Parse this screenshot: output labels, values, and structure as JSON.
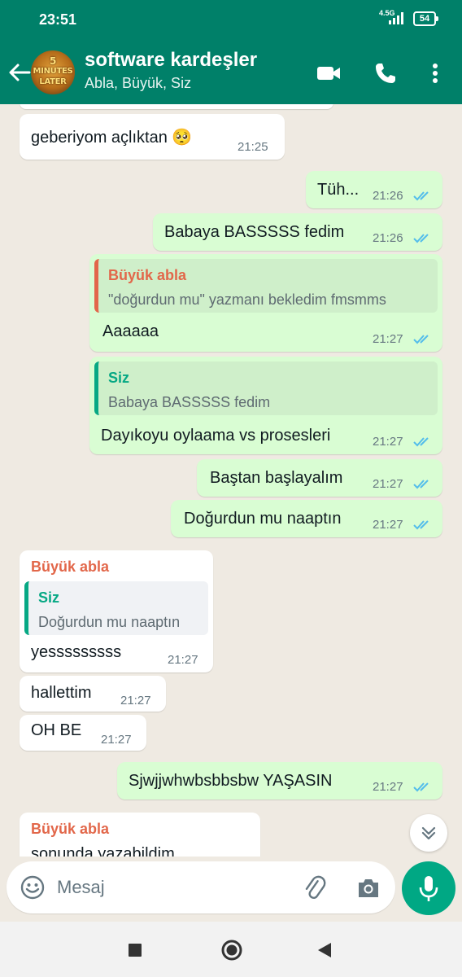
{
  "status_bar": {
    "time": "23:51",
    "network": "4.5G",
    "battery": "54"
  },
  "header": {
    "title": "software kardeşler",
    "subtitle": "Abla, Büyük, Siz",
    "avatar_text": [
      "5",
      "MINUTES",
      "LATER"
    ],
    "icons": [
      "back-arrow-icon",
      "video-call-icon",
      "phone-icon",
      "more-vert-icon"
    ]
  },
  "messages": [
    {
      "dir": "in",
      "text": "geberiyom açlıktan 🥺",
      "time": "21:25"
    },
    {
      "dir": "out",
      "text": "Tüh...",
      "time": "21:26",
      "read": true
    },
    {
      "dir": "out",
      "text": "Babaya BASSSSS fedim",
      "time": "21:26",
      "read": true
    },
    {
      "dir": "out",
      "reply": {
        "name": "Büyük abla",
        "text": "\"doğurdun mu\" yazmanı bekledim fmsmms"
      },
      "text": "Aaaaaa",
      "time": "21:27",
      "read": true
    },
    {
      "dir": "out",
      "reply": {
        "name": "Siz",
        "text": "Babaya BASSSSS fedim"
      },
      "text": "Dayıkoyu oylaama vs prosesleri",
      "time": "21:27",
      "read": true
    },
    {
      "dir": "out",
      "text": "Baştan başlayalım",
      "time": "21:27",
      "read": true
    },
    {
      "dir": "out",
      "text": "Doğurdun mu naaptın",
      "time": "21:27",
      "read": true
    },
    {
      "dir": "in",
      "sender": "Büyük abla",
      "reply": {
        "name": "Siz",
        "text": "Doğurdun mu naaptın"
      },
      "text": "yesssssssss",
      "time": "21:27"
    },
    {
      "dir": "in",
      "text": "hallettim",
      "time": "21:27"
    },
    {
      "dir": "in",
      "text": "OH BE",
      "time": "21:27"
    },
    {
      "dir": "out",
      "text": "Sjwjjwhwbsbbsbw YAŞASIN",
      "time": "21:27",
      "read": true
    },
    {
      "dir": "in",
      "sender": "Büyük abla",
      "text": "sonunda yazabildim",
      "time": ""
    }
  ],
  "input": {
    "placeholder": "Mesaj"
  },
  "colors": {
    "header": "#008069",
    "chat_bg": "#efeae2",
    "outgoing": "#d9fdd3",
    "incoming": "#ffffff",
    "read_tick": "#53bdeb",
    "sender_orange": "#e2674a",
    "quote_green": "#06a884",
    "mic": "#00a884"
  }
}
